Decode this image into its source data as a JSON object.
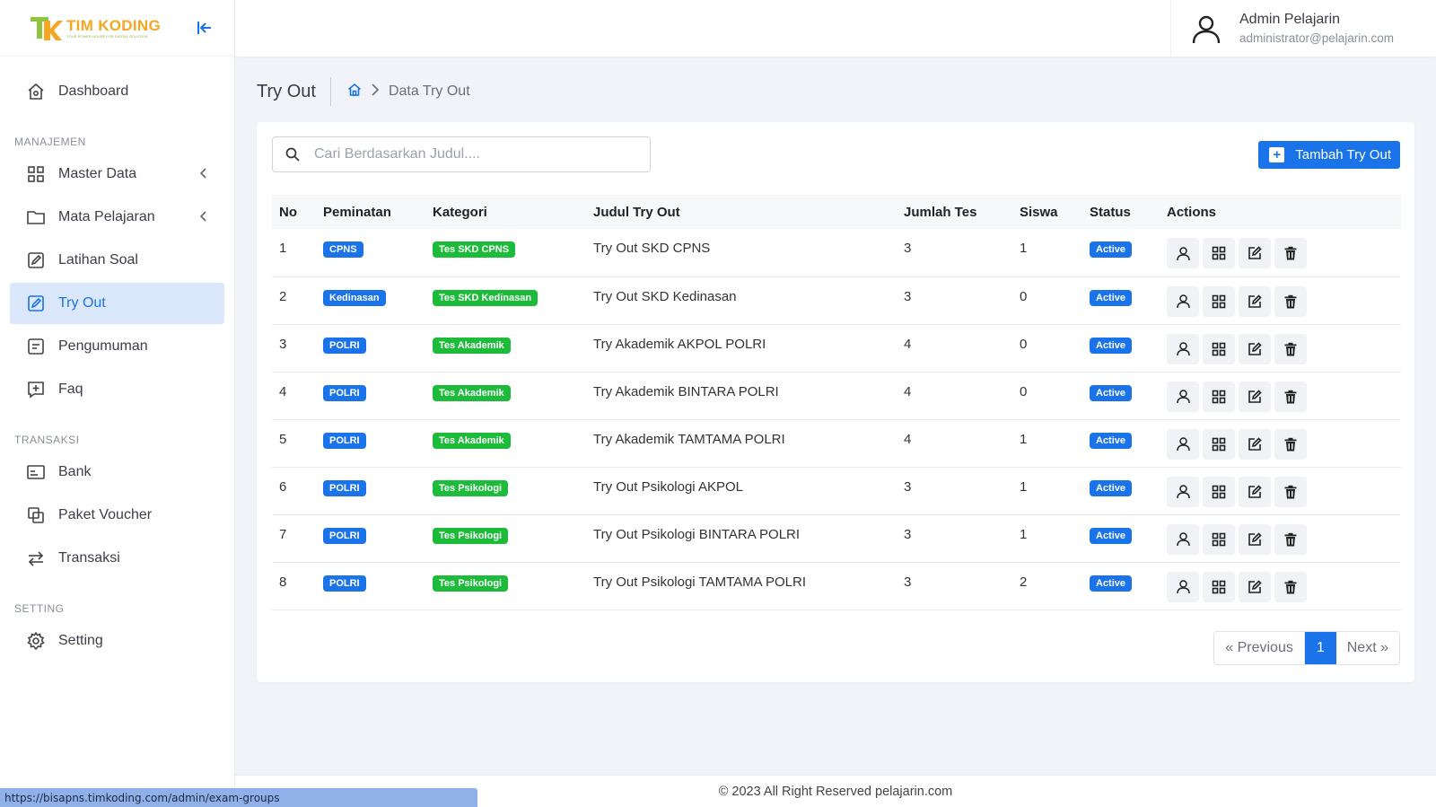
{
  "brand": {
    "name": "TIM KODING",
    "tagline": "YOUR POWER HOUSE FOR DIGITAL SOLUTION"
  },
  "sidebar": {
    "items": [
      {
        "label": "Dashboard",
        "icon": "home-icon"
      },
      {
        "section": "MANAJEMEN"
      },
      {
        "label": "Master Data",
        "icon": "grid-icon",
        "expandable": true
      },
      {
        "label": "Mata Pelajaran",
        "icon": "folder-icon",
        "expandable": true
      },
      {
        "label": "Latihan Soal",
        "icon": "edit-icon"
      },
      {
        "label": "Try Out",
        "icon": "edit-icon",
        "active": true
      },
      {
        "label": "Pengumuman",
        "icon": "note-icon"
      },
      {
        "label": "Faq",
        "icon": "faq-icon"
      },
      {
        "section": "TRANSAKSI"
      },
      {
        "label": "Bank",
        "icon": "card-icon"
      },
      {
        "label": "Paket Voucher",
        "icon": "copy-icon"
      },
      {
        "label": "Transaksi",
        "icon": "transfer-icon"
      },
      {
        "section": "SETTING"
      },
      {
        "label": "Setting",
        "icon": "gear-icon"
      }
    ]
  },
  "user": {
    "name": "Admin Pelajarin",
    "email": "administrator@pelajarin.com"
  },
  "page": {
    "title": "Try Out",
    "breadcrumb": "Data Try Out"
  },
  "search": {
    "placeholder": "Cari Berdasarkan Judul...."
  },
  "add_button": "Tambah Try Out",
  "table": {
    "headers": [
      "No",
      "Peminatan",
      "Kategori",
      "Judul Try Out",
      "Jumlah Tes",
      "Siswa",
      "Status",
      "Actions"
    ],
    "rows": [
      {
        "no": "1",
        "peminatan": "CPNS",
        "kategori": "Tes SKD CPNS",
        "judul": "Try Out SKD CPNS",
        "jumlah": "3",
        "siswa": "1",
        "status": "Active"
      },
      {
        "no": "2",
        "peminatan": "Kedinasan",
        "kategori": "Tes SKD Kedinasan",
        "judul": "Try Out SKD Kedinasan",
        "jumlah": "3",
        "siswa": "0",
        "status": "Active"
      },
      {
        "no": "3",
        "peminatan": "POLRI",
        "kategori": "Tes Akademik",
        "judul": "Try Akademik AKPOL POLRI",
        "jumlah": "4",
        "siswa": "0",
        "status": "Active"
      },
      {
        "no": "4",
        "peminatan": "POLRI",
        "kategori": "Tes Akademik",
        "judul": "Try Akademik BINTARA POLRI",
        "jumlah": "4",
        "siswa": "0",
        "status": "Active"
      },
      {
        "no": "5",
        "peminatan": "POLRI",
        "kategori": "Tes Akademik",
        "judul": "Try Akademik TAMTAMA POLRI",
        "jumlah": "4",
        "siswa": "1",
        "status": "Active"
      },
      {
        "no": "6",
        "peminatan": "POLRI",
        "kategori": "Tes Psikologi",
        "judul": "Try Out Psikologi AKPOL",
        "jumlah": "3",
        "siswa": "1",
        "status": "Active"
      },
      {
        "no": "7",
        "peminatan": "POLRI",
        "kategori": "Tes Psikologi",
        "judul": "Try Out Psikologi BINTARA POLRI",
        "jumlah": "3",
        "siswa": "1",
        "status": "Active"
      },
      {
        "no": "8",
        "peminatan": "POLRI",
        "kategori": "Tes Psikologi",
        "judul": "Try Out Psikologi TAMTAMA POLRI",
        "jumlah": "3",
        "siswa": "2",
        "status": "Active"
      }
    ]
  },
  "pagination": {
    "previous": "« Previous",
    "current": "1",
    "next": "Next »"
  },
  "footer": "© 2023 All Right Reserved pelajarin.com",
  "status_url": "https://bisapns.timkoding.com/admin/exam-groups",
  "colors": {
    "primary": "#1a73e8",
    "success": "#1dbb3a",
    "active_bg": "#dbe7fb"
  }
}
